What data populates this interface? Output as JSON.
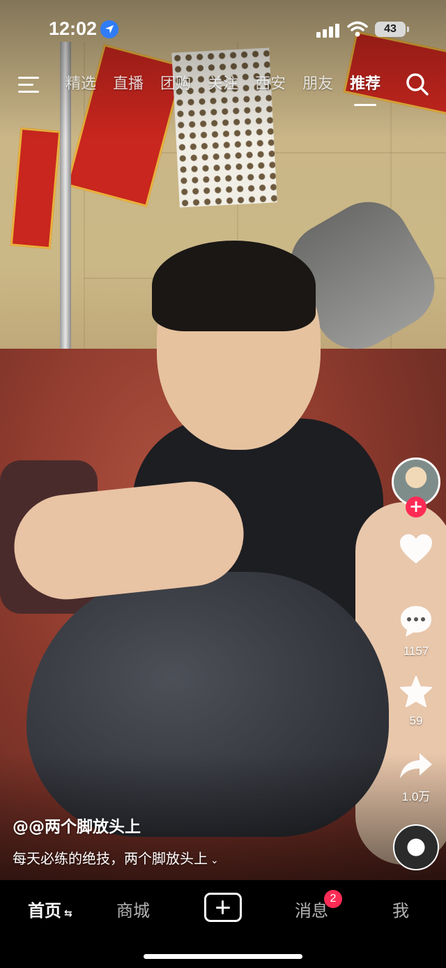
{
  "status_bar": {
    "time": "12:02",
    "battery": "43",
    "icons": [
      "location-arrow-icon",
      "signal-icon",
      "wifi-icon",
      "battery-icon"
    ]
  },
  "top_nav": {
    "menu_icon": "hamburger-menu-icon",
    "tabs": [
      {
        "label": "精选",
        "active": false
      },
      {
        "label": "直播",
        "active": false
      },
      {
        "label": "团购",
        "active": false
      },
      {
        "label": "关注",
        "active": false
      },
      {
        "label": "西安",
        "active": false
      },
      {
        "label": "朋友",
        "active": false
      },
      {
        "label": "推荐",
        "active": true
      }
    ],
    "search_icon": "search-icon"
  },
  "right_rail": {
    "follow_icon": "plus-icon",
    "like_count": "",
    "comment_count": "1157",
    "favorite_count": "59",
    "share_count": "1.0万"
  },
  "caption": {
    "author": "@@两个脚放头上",
    "description": "每天必练的绝技，两个脚放头上"
  },
  "tab_bar": {
    "tabs": [
      "首页",
      "商城",
      "消息",
      "我"
    ],
    "messages_badge": "2",
    "create_icon": "plus-square-icon"
  },
  "colors": {
    "accent": "#fe2c55",
    "location": "#2f7cf6",
    "tab_bar_bg": "#000000"
  }
}
